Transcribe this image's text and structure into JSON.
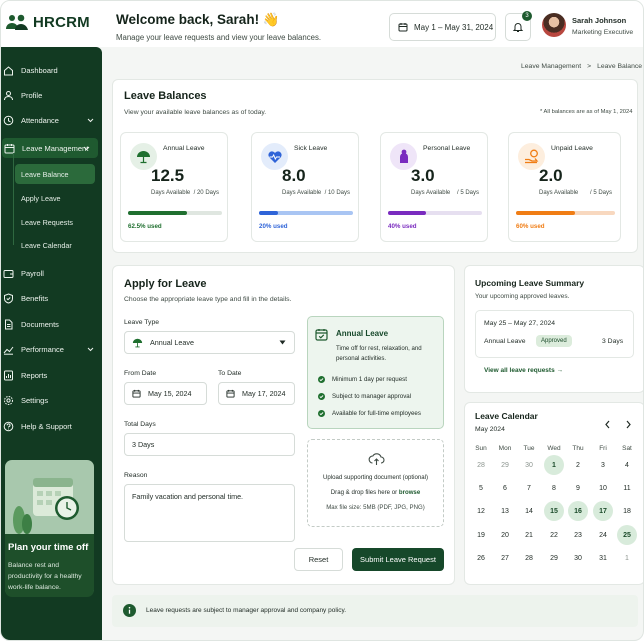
{
  "header": {
    "logo": "HRCRM",
    "welcome": "Welcome back, Sarah! 👋",
    "subtitle": "Manage your leave requests and view your leave balances.",
    "date_range": "May 1 – May 31, 2024",
    "notification_count": "3",
    "user_name": "Sarah Johnson",
    "user_role": "Marketing Executive"
  },
  "sidebar": {
    "items": [
      {
        "label": "Dashboard",
        "icon": "home-icon"
      },
      {
        "label": "Profile",
        "icon": "user-icon"
      },
      {
        "label": "Attendance",
        "icon": "clock-icon"
      },
      {
        "label": "Leave Management",
        "icon": "calendar-icon"
      },
      {
        "label": "Payroll",
        "icon": "wallet-icon"
      },
      {
        "label": "Benefits",
        "icon": "shield-icon"
      },
      {
        "label": "Documents",
        "icon": "document-icon"
      },
      {
        "label": "Performance",
        "icon": "chart-icon"
      },
      {
        "label": "Reports",
        "icon": "report-icon"
      },
      {
        "label": "Settings",
        "icon": "gear-icon"
      },
      {
        "label": "Help & Support",
        "icon": "help-icon"
      }
    ],
    "sub_items": [
      "Leave Balance",
      "Apply Leave",
      "Leave Requests",
      "Leave Calendar"
    ],
    "promo_title": "Plan your time off",
    "promo_desc": "Balance rest and productivity for a healthy work-life balance."
  },
  "breadcrumb": {
    "parent": "Leave Management",
    "sep": ">",
    "current": "Leave Balance"
  },
  "balances": {
    "title": "Leave Balances",
    "desc": "View your available leave balances as of today.",
    "note": "* All balances are as of May 1, 2024",
    "days_label": "Days Available",
    "cards": [
      {
        "name": "Annual Leave",
        "value": "12.5",
        "total": "/ 20 Days",
        "used": "62.5% used",
        "used_fraction": 0.625,
        "color": "#1f6f2f",
        "track": "#dfe6e0",
        "icon": "umbrella-icon",
        "icon_bg": "#e5f0e6"
      },
      {
        "name": "Sick Leave",
        "value": "8.0",
        "total": "/ 10 Days",
        "used": "20% used",
        "used_fraction": 0.2,
        "color": "#2f64d8",
        "track": "#a9c5f3",
        "icon": "heartbeat-icon",
        "icon_bg": "#e3ecfb"
      },
      {
        "name": "Personal Leave",
        "value": "3.0",
        "total": "/ 5 Days",
        "used": "40% used",
        "used_fraction": 0.4,
        "color": "#7a2bbf",
        "track": "#e6dff0",
        "icon": "person-icon",
        "icon_bg": "#efe5f8"
      },
      {
        "name": "Unpaid Leave",
        "value": "2.0",
        "total": "/ 5 Days",
        "used": "60% used",
        "used_fraction": 0.6,
        "color": "#f07d15",
        "track": "#f8d8bf",
        "icon": "coin-hand-icon",
        "icon_bg": "#fdeede"
      }
    ]
  },
  "apply": {
    "title": "Apply for Leave",
    "desc": "Choose the appropriate leave type and fill in the details.",
    "type_label": "Leave Type",
    "type_value": "Annual Leave",
    "from_label": "From Date",
    "from_value": "May 15, 2024",
    "to_label": "To Date",
    "to_value": "May 17, 2024",
    "total_label": "Total Days",
    "total_value": "3 Days",
    "reason_label": "Reason",
    "reason_value": "Family vacation and personal time.",
    "info_title": "Annual Leave",
    "info_desc": "Time off for rest, relaxation, and personal activities.",
    "features": [
      "Minimum 1 day per request",
      "Subject to manager approval",
      "Available for full-time employees"
    ],
    "upload_title": "Upload supporting document (optional)",
    "upload_drag": "Drag & drop files here or",
    "upload_browse": "browse",
    "upload_limit": "Max file size: 5MB (PDF, JPG, PNG)",
    "reset": "Reset",
    "submit": "Submit Leave Request"
  },
  "upcoming": {
    "title": "Upcoming Leave Summary",
    "desc": "Your upcoming approved leaves.",
    "range": "May 25 – May 27, 2024",
    "type": "Annual Leave",
    "status": "Approved",
    "days": "3 Days",
    "link": "View all leave requests →"
  },
  "calendar": {
    "title": "Leave Calendar",
    "month": "May 2024",
    "weekdays": [
      "Sun",
      "Mon",
      "Tue",
      "Wed",
      "Thu",
      "Fri",
      "Sat"
    ],
    "weeks": [
      [
        "28",
        "29",
        "30",
        "1",
        "2",
        "3",
        "4"
      ],
      [
        "5",
        "6",
        "7",
        "8",
        "9",
        "10",
        "11"
      ],
      [
        "12",
        "13",
        "14",
        "15",
        "16",
        "17",
        "18"
      ],
      [
        "19",
        "20",
        "21",
        "22",
        "23",
        "24",
        "25"
      ],
      [
        "26",
        "27",
        "28",
        "29",
        "30",
        "31",
        "1"
      ]
    ],
    "muted": [
      [
        0,
        0
      ],
      [
        0,
        1
      ],
      [
        0,
        2
      ],
      [
        4,
        6
      ]
    ],
    "highlighted": [
      [
        0,
        3
      ],
      [
        2,
        3
      ],
      [
        2,
        4
      ],
      [
        2,
        5
      ],
      [
        3,
        6
      ]
    ]
  },
  "footer": {
    "text": "Leave requests are subject to manager approval and company policy."
  }
}
